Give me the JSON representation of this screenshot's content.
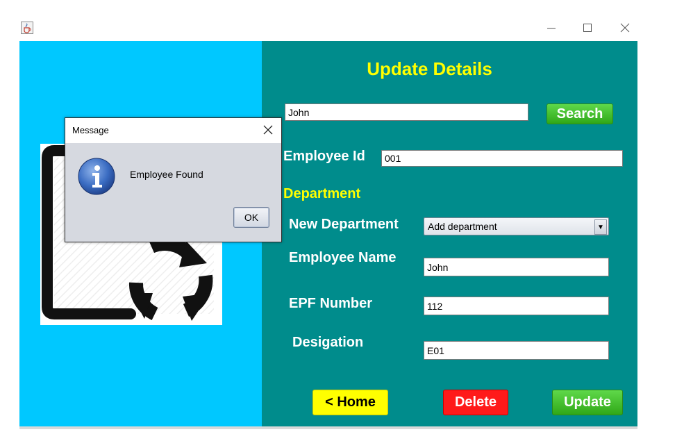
{
  "window": {
    "app_icon": "java-cup-icon",
    "controls": [
      "minimize-icon",
      "maximize-icon",
      "close-icon"
    ]
  },
  "form": {
    "title": "Update Details",
    "search": {
      "value": "John",
      "button_label": "Search"
    },
    "employee_id": {
      "label": "Employee Id",
      "value": "001"
    },
    "department_heading": "Department",
    "new_department": {
      "label": "New Department",
      "selected": "Add department"
    },
    "employee_name": {
      "label": "Employee Name",
      "value": "John"
    },
    "epf_number": {
      "label": "EPF Number",
      "value": "112"
    },
    "designation": {
      "label": "Desigation",
      "value": "E01"
    },
    "buttons": {
      "home": "< Home",
      "delete": "Delete",
      "update": "Update"
    }
  },
  "dialog": {
    "title": "Message",
    "message": "Employee Found",
    "ok_label": "OK",
    "icon": "info-icon"
  },
  "colors": {
    "left_panel": "#00c8ff",
    "right_panel": "#008c8c",
    "title": "#ffff00",
    "search_button": "#30a818",
    "home_button": "#ffff00",
    "delete_button": "#ff1a1a",
    "update_button": "#30a818"
  }
}
